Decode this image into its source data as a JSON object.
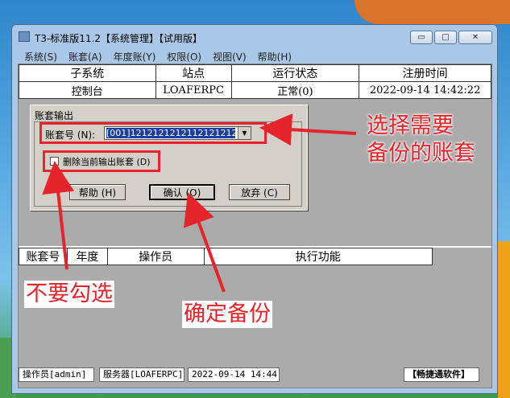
{
  "window": {
    "title": "T3-标准版11.2【系统管理】【试用版】",
    "buttons": {
      "minimize": "▭",
      "maximize": "□",
      "close": "✕"
    }
  },
  "menubar": [
    "系统(S)",
    "账套(A)",
    "年度账(Y)",
    "权限(O)",
    "视图(V)",
    "帮助(H)"
  ],
  "top_table": {
    "headers": [
      "子系统",
      "站点",
      "运行状态",
      "注册时间"
    ],
    "rows": [
      [
        "控制台",
        "LOAFERPC",
        "正常(0)",
        "2022-09-14 14:42:22"
      ]
    ]
  },
  "dialog": {
    "title": "账套输出",
    "account_label": "账套号 (N):",
    "account_value": "[001]121212121211212121212121",
    "delete_checkbox_label": "删除当前输出账套 (D)",
    "delete_checked": false,
    "help_button": "帮助 (H)",
    "ok_button": "确认 (O)",
    "cancel_button": "放弃 (C)"
  },
  "bottom_table": {
    "headers": [
      "账套号",
      "年度",
      "操作员",
      "执行功能"
    ]
  },
  "statusbar": {
    "operator": "操作员[admin]",
    "server": "服务器[LOAFERPC]",
    "datetime": "2022-09-14 14:44",
    "company": "【畅捷通软件】"
  },
  "annotations": {
    "select_account": [
      "选择需要",
      "备份的账套"
    ],
    "no_check": "不要勾选",
    "confirm_backup": "确定备份",
    "color": "#e5242b"
  }
}
